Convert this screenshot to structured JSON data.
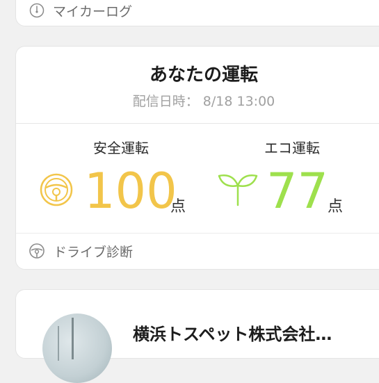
{
  "my_car_log": {
    "label": "マイカーログ",
    "icon": "gauge-icon"
  },
  "driving": {
    "title": "あなたの運転",
    "date_label": "配信日時：",
    "date_value": "8/18 13:00",
    "safe": {
      "label": "安全運転",
      "score": "100",
      "unit": "点",
      "color": "#f2c54a",
      "icon": "steering-wheel-icon"
    },
    "eco": {
      "label": "エコ運転",
      "score": "77",
      "unit": "点",
      "color": "#9ee04d",
      "icon": "sprout-icon"
    }
  },
  "drive_diagnosis": {
    "label": "ドライブ診断",
    "icon": "steering-wheel-icon"
  },
  "spot": {
    "title": "横浜トスペット株式会社…"
  }
}
